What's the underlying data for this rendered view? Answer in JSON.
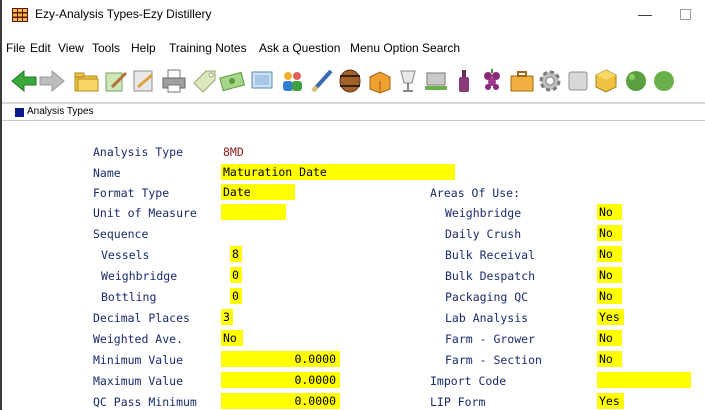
{
  "window": {
    "title": "Ezy-Analysis Types-Ezy Distillery",
    "min_symbol": "—"
  },
  "menu": [
    "File",
    "Edit",
    "View",
    "Tools",
    "Help",
    "Training Notes",
    "Ask a Question",
    "Menu Option Search"
  ],
  "toolbar": {
    "icons": [
      "back-icon",
      "forward-icon",
      "open-folder-icon",
      "edit-icon",
      "notes-icon",
      "printer-icon",
      "tag-icon",
      "screen-icon",
      "people-icon",
      "pen-icon",
      "barrel-icon",
      "box-icon",
      "glass-icon",
      "pallet-icon",
      "bottle-icon",
      "grapes-icon",
      "briefcase-icon",
      "gear-icon",
      "grid-icon",
      "cube-icon",
      "green-icon",
      "dollar-icon"
    ]
  },
  "subwindow": {
    "title": "Analysis Types",
    "icon_color": "#0a1a8a"
  },
  "colors": {
    "field_bg": "#ffff00",
    "label": "#1a2a6e",
    "code_value": "#8b1a1a"
  },
  "form": {
    "analysis_type_label": "Analysis Type",
    "analysis_type_value": "8MD",
    "name_label": "Name",
    "name_value": "Maturation Date",
    "format_type_label": "Format Type",
    "format_type_value": "Date",
    "unit_label": "Unit of Measure",
    "unit_value": "",
    "sequence_label": "Sequence",
    "vessels_label": "Vessels",
    "vessels_value": "8",
    "weighbridge_label": "Weighbridge",
    "weighbridge_value": "0",
    "bottling_label": "Bottling",
    "bottling_value": "0",
    "decimal_label": "Decimal Places",
    "decimal_value": "3",
    "weighted_label": "Weighted Ave.",
    "weighted_value": "No",
    "min_label": "Minimum Value",
    "min_value": "0.0000",
    "max_label": "Maximum Value",
    "max_value": "0.0000",
    "qc_label": "QC Pass Minimum",
    "qc_value": "0.0000",
    "areas_label": "Areas Of Use:",
    "areas": [
      {
        "label": "Weighbridge",
        "value": "No"
      },
      {
        "label": "Daily Crush",
        "value": "No"
      },
      {
        "label": "Bulk Receival",
        "value": "No"
      },
      {
        "label": "Bulk Despatch",
        "value": "No"
      },
      {
        "label": "Packaging QC",
        "value": "No"
      },
      {
        "label": "Lab Analysis",
        "value": "Yes"
      },
      {
        "label": "Farm - Grower",
        "value": "No"
      },
      {
        "label": "Farm - Section",
        "value": "No"
      }
    ],
    "import_label": "Import Code",
    "import_value": "",
    "lip_label": "LIP Form",
    "lip_value": "Yes"
  }
}
